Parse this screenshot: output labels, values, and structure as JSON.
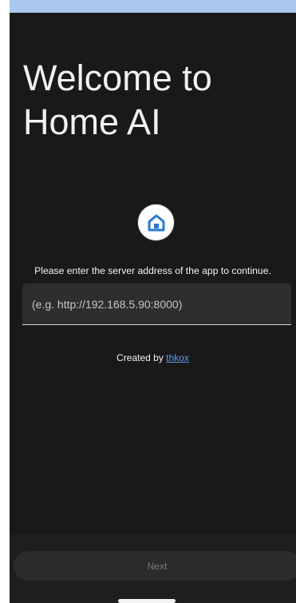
{
  "status_bar": {
    "background": "#a9c7f0"
  },
  "welcome": {
    "title_line_1": "Welcome to",
    "title_line_2": "Home AI"
  },
  "logo": {
    "icon": "home-icon",
    "color": "#2a78d3"
  },
  "server": {
    "prompt": "Please enter the server address of the app to continue.",
    "value": "",
    "placeholder": "(e.g. http://192.168.5.90:8000)"
  },
  "credit": {
    "prefix": "Created by",
    "author": "thkox",
    "link_color": "#5b9fec"
  },
  "actions": {
    "next_label": "Next"
  },
  "theme": {
    "background": "#191919",
    "text": "#f1f1f1",
    "input_background": "#2e2e2e",
    "button_background": "#2b2b2b",
    "button_text": "#7a7a7a"
  }
}
